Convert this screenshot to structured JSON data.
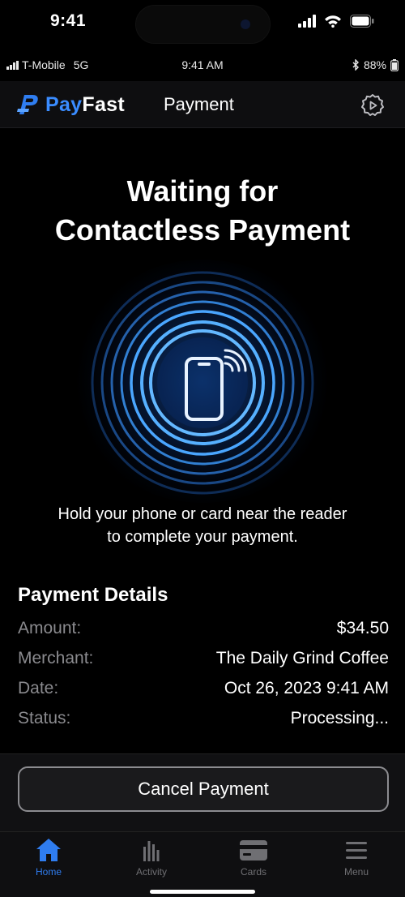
{
  "device_status": {
    "time": "9:41"
  },
  "app_status": {
    "carrier": "T-Mobile",
    "network": "5G",
    "time": "9:41 AM",
    "battery": "88%"
  },
  "header": {
    "brand_prefix": "Pay",
    "brand_suffix": "Fast",
    "title": "Payment"
  },
  "hero": {
    "line1": "Waiting for",
    "line2": "Contactless Payment"
  },
  "instruction": {
    "line1": "Hold your phone or card near the reader",
    "line2": "to complete your payment."
  },
  "details": {
    "title": "Payment Details",
    "rows": [
      {
        "label": "Amount:",
        "value": "$34.50"
      },
      {
        "label": "Merchant:",
        "value": "The Daily Grind Coffee"
      },
      {
        "label": "Date:",
        "value": "Oct 26, 2023 9:41 AM"
      },
      {
        "label": "Status:",
        "value": "Processing..."
      }
    ]
  },
  "cancel_label": "Cancel Payment",
  "tabs": [
    {
      "label": "Home",
      "icon": "home-icon",
      "active": true
    },
    {
      "label": "Activity",
      "icon": "activity-icon",
      "active": false
    },
    {
      "label": "Cards",
      "icon": "card-icon",
      "active": false
    },
    {
      "label": "Menu",
      "icon": "menu-icon",
      "active": false
    }
  ],
  "colors": {
    "accent": "#2f7df0",
    "brand": "#3a8cff",
    "ring": "#3da3ff",
    "background": "#000000"
  }
}
